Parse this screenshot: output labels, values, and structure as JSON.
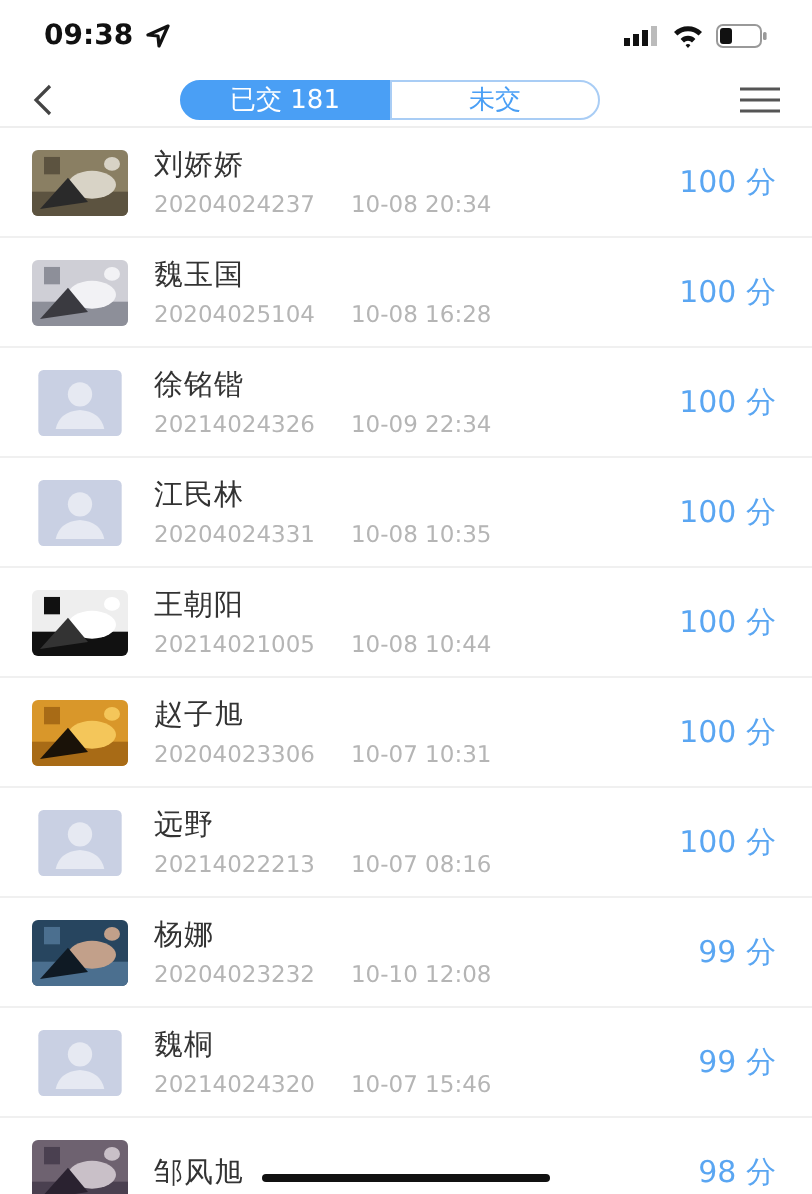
{
  "status_bar": {
    "time": "09:38"
  },
  "tabs": [
    {
      "label": "已交 181",
      "selected": true
    },
    {
      "label": "未交",
      "selected": false
    }
  ],
  "rows": [
    {
      "name": "刘娇娇",
      "id": "20204024237",
      "time": "10-08 20:34",
      "score": "100 分"
    },
    {
      "name": "魏玉国",
      "id": "20204025104",
      "time": "10-08 16:28",
      "score": "100 分"
    },
    {
      "avatar": {
        "kind": "placeholder"
      },
      "name": "徐铭锴",
      "id": "20214024326",
      "time": "10-09 22:34",
      "score": "100 分"
    },
    {
      "avatar": {
        "kind": "placeholder"
      },
      "name": "江民林",
      "id": "20204024331",
      "time": "10-08 10:35",
      "score": "100 分"
    },
    {
      "name": "王朝阳",
      "id": "20214021005",
      "time": "10-08 10:44",
      "score": "100 分"
    },
    {
      "name": "赵子旭",
      "id": "20204023306",
      "time": "10-07 10:31",
      "score": "100 分"
    },
    {
      "avatar": {
        "kind": "placeholder"
      },
      "name": "远野",
      "id": "20214022213",
      "time": "10-07 08:16",
      "score": "100 分"
    },
    {
      "name": "杨娜",
      "id": "20204023232",
      "time": "10-10 12:08",
      "score": "99 分"
    },
    {
      "avatar": {
        "kind": "placeholder"
      },
      "name": "魏桐",
      "id": "20214024320",
      "time": "10-07 15:46",
      "score": "99 分"
    },
    {
      "name": "邹风旭",
      "score": "98 分"
    }
  ]
}
